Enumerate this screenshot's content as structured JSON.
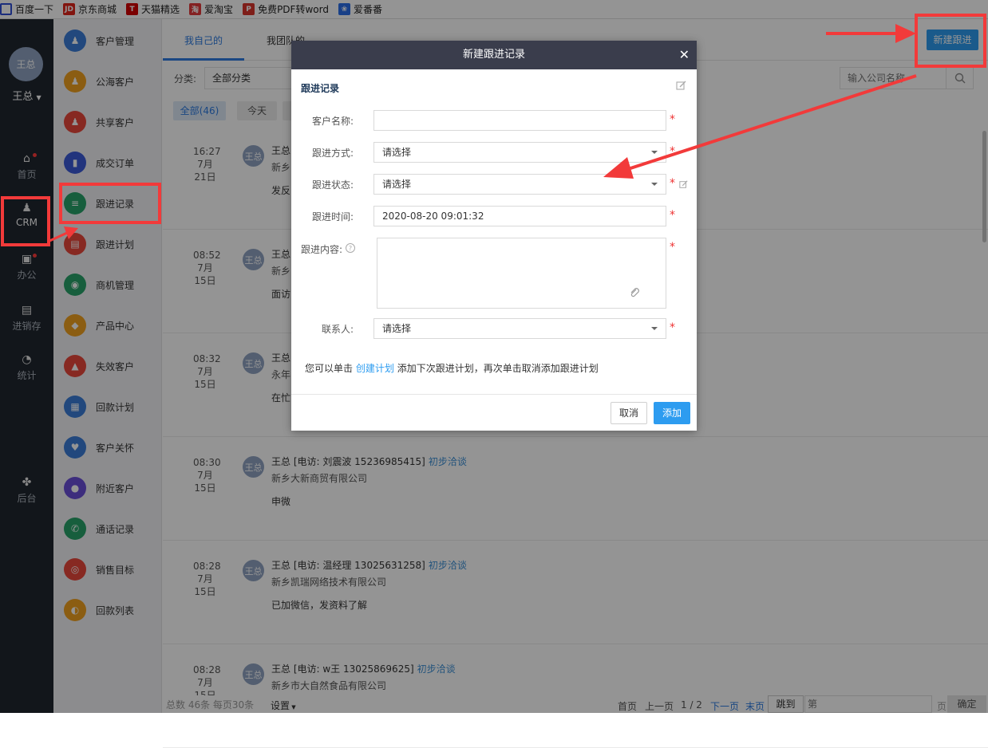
{
  "bookmarks": [
    {
      "label": "百度一下",
      "icon": "baidu-icon",
      "color": "#2f4fd6"
    },
    {
      "label": "京东商城",
      "icon": "jd-icon",
      "color": "#e1251b",
      "glyph": "JD"
    },
    {
      "label": "天猫精选",
      "icon": "tmall-icon",
      "color": "#d40000",
      "glyph": "T"
    },
    {
      "label": "爱淘宝",
      "icon": "taobao-icon",
      "color": "#e4393c",
      "glyph": "淘"
    },
    {
      "label": "免费PDF转word",
      "icon": "pdf-icon",
      "color": "#d9342b",
      "glyph": "P"
    },
    {
      "label": "爱番番",
      "icon": "paw-icon",
      "color": "#2b6fe8",
      "glyph": "❀"
    }
  ],
  "user": {
    "avatar_text": "王总",
    "name": "王总"
  },
  "left_nav": [
    {
      "label": "首页",
      "icon": "home-icon",
      "glyph": "⌂"
    },
    {
      "label": "CRM",
      "icon": "crm-users-icon",
      "glyph": "♟"
    },
    {
      "label": "办公",
      "icon": "briefcase-icon",
      "glyph": "▣"
    },
    {
      "label": "进销存",
      "icon": "inventory-icon",
      "glyph": "▤"
    },
    {
      "label": "统计",
      "icon": "pie-chart-icon",
      "glyph": "◔"
    },
    {
      "label": "后台",
      "icon": "grid-icon",
      "glyph": "✤"
    }
  ],
  "sub_nav": [
    {
      "label": "客户管理",
      "icon": "customer-icon",
      "color": "#3b7dd8",
      "glyph": "♟"
    },
    {
      "label": "公海客户",
      "icon": "public-customer-icon",
      "color": "#f0a020",
      "glyph": "♟"
    },
    {
      "label": "共享客户",
      "icon": "share-customer-icon",
      "color": "#e8473b",
      "glyph": "♟"
    },
    {
      "label": "成交订单",
      "icon": "order-icon",
      "color": "#3b5bd8",
      "glyph": "▮"
    },
    {
      "label": "跟进记录",
      "icon": "followup-record-icon",
      "color": "#29a36a",
      "glyph": "≡"
    },
    {
      "label": "跟进计划",
      "icon": "followup-plan-icon",
      "color": "#e8473b",
      "glyph": "▤"
    },
    {
      "label": "商机管理",
      "icon": "opportunity-icon",
      "color": "#29a36a",
      "glyph": "◉"
    },
    {
      "label": "产品中心",
      "icon": "product-icon",
      "color": "#f0a020",
      "glyph": "◆"
    },
    {
      "label": "失效客户",
      "icon": "warning-icon",
      "color": "#e8473b",
      "glyph": "▲"
    },
    {
      "label": "回款计划",
      "icon": "payment-plan-icon",
      "color": "#3b7dd8",
      "glyph": "▦"
    },
    {
      "label": "客户关怀",
      "icon": "care-icon",
      "color": "#3b7dd8",
      "glyph": "♥"
    },
    {
      "label": "附近客户",
      "icon": "location-icon",
      "color": "#6a4ed8",
      "glyph": "●"
    },
    {
      "label": "通话记录",
      "icon": "phone-icon",
      "color": "#29a36a",
      "glyph": "✆"
    },
    {
      "label": "销售目标",
      "icon": "target-icon",
      "color": "#e8473b",
      "glyph": "◎"
    },
    {
      "label": "回款列表",
      "icon": "payment-list-icon",
      "color": "#f0a020",
      "glyph": "◐"
    }
  ],
  "main": {
    "tabs": [
      "我自己的",
      "我团队的"
    ],
    "filter_label": "分类:",
    "filter_value": "全部分类",
    "search_placeholder": "输入公司名称",
    "chips": [
      "全部(46)",
      "今天"
    ],
    "new_button": "新建跟进"
  },
  "records": [
    {
      "time": "16:27",
      "date": "7月21日",
      "avatar": "王总",
      "head": "王总",
      "status": "",
      "company": "新乡",
      "content": "发反"
    },
    {
      "time": "08:52",
      "date": "7月15日",
      "avatar": "王总",
      "head": "王总",
      "status": "",
      "company": "新乡",
      "content": "面访"
    },
    {
      "time": "08:32",
      "date": "7月15日",
      "avatar": "王总",
      "head": "王总",
      "status": "",
      "company": "永年",
      "content": "在忙"
    },
    {
      "time": "08:30",
      "date": "7月15日",
      "avatar": "王总",
      "head": "王总 [电访: 刘震波 15236985415]",
      "status": "初步洽谈",
      "company": "新乡大新商贸有限公司",
      "content": "申微"
    },
    {
      "time": "08:28",
      "date": "7月15日",
      "avatar": "王总",
      "head": "王总 [电访: 温经理 13025631258]",
      "status": "初步洽谈",
      "company": "新乡凯瑞网络技术有限公司",
      "content": "已加微信，发资料了解"
    },
    {
      "time": "08:28",
      "date": "7月15日",
      "avatar": "王总",
      "head": "王总 [电访: w王 13025869625]",
      "status": "初步洽谈",
      "company": "新乡市大自然食品有限公司",
      "content": ""
    }
  ],
  "footer": {
    "summary": "总数 46条 每页30条",
    "settings": "设置",
    "first": "首页",
    "prev": "上一页",
    "page": "1 / 2",
    "next": "下一页",
    "last": "末页",
    "jump": "跳到",
    "page_placeholder": "第",
    "page_suffix": "页",
    "confirm": "确定"
  },
  "modal": {
    "title": "新建跟进记录",
    "section": "跟进记录",
    "fields": {
      "customer_label": "客户名称:",
      "method_label": "跟进方式:",
      "method_value": "请选择",
      "status_label": "跟进状态:",
      "status_value": "请选择",
      "time_label": "跟进时间:",
      "time_value": "2020-08-20 09:01:32",
      "content_label": "跟进内容:",
      "contact_label": "联系人:",
      "contact_value": "请选择"
    },
    "hint_prefix": "您可以单击",
    "hint_link": "创建计划",
    "hint_suffix": "添加下次跟进计划，再次单击取消添加跟进计划",
    "cancel": "取消",
    "add": "添加"
  },
  "colors": {
    "accent": "#2d9cf0",
    "dark": "#20262f",
    "annotation": "#f23a3a"
  }
}
